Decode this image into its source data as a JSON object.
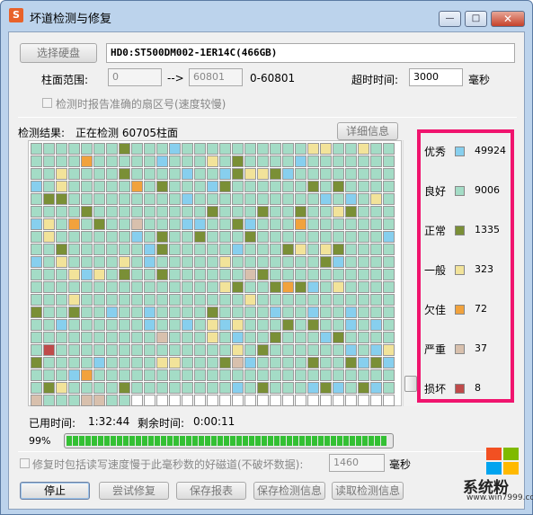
{
  "window": {
    "title": "坏道检测与修复",
    "app_icon": "S",
    "minimize": "—",
    "maximize": "□",
    "close": "✕"
  },
  "disk": {
    "select_button": "选择硬盘",
    "name": "HD0:ST500DM002-1ER14C(466GB)"
  },
  "range": {
    "label": "柱面范围:",
    "start": "0",
    "arrow": "-->",
    "end": "60801",
    "span": "0-60801"
  },
  "timeout": {
    "label": "超时时间:",
    "value": "3000",
    "unit": "毫秒"
  },
  "report_option": {
    "label": "检测时报告准确的扇区号(速度较慢)",
    "checked": false
  },
  "result": {
    "label": "检测结果:",
    "status": "正在检测 60705柱面",
    "details_button": "详细信息"
  },
  "legend": [
    {
      "label": "优秀",
      "count": "49924",
      "color": "#87cfee"
    },
    {
      "label": "良好",
      "count": "9006",
      "color": "#a4dcc6"
    },
    {
      "label": "正常",
      "count": "1335",
      "color": "#7a8f36"
    },
    {
      "label": "一般",
      "count": "323",
      "color": "#f2e39a"
    },
    {
      "label": "欠佳",
      "count": "72",
      "color": "#f1a23d"
    },
    {
      "label": "严重",
      "count": "37",
      "color": "#d8c0ad"
    },
    {
      "label": "损坏",
      "count": "8",
      "color": "#bf4a4a"
    }
  ],
  "time": {
    "elapsed_label": "已用时间:",
    "elapsed": "1:32:44",
    "remaining_label": "剩余时间:",
    "remaining": "0:00:11"
  },
  "progress": {
    "text": "99%",
    "value": 0.99
  },
  "repair_option": {
    "label": "修复时包括读写速度慢于此毫秒数的好磁道(不破坏数据):",
    "value": "1460",
    "unit": "毫秒",
    "checked": false
  },
  "buttons": {
    "stop": "停止",
    "try_repair": "尝试修复",
    "save_report": "保存报表",
    "save_check": "保存检测信息",
    "read_check": "读取检测信息"
  },
  "watermark": {
    "brand": "系统粉",
    "url": "www.win7999.com"
  }
}
